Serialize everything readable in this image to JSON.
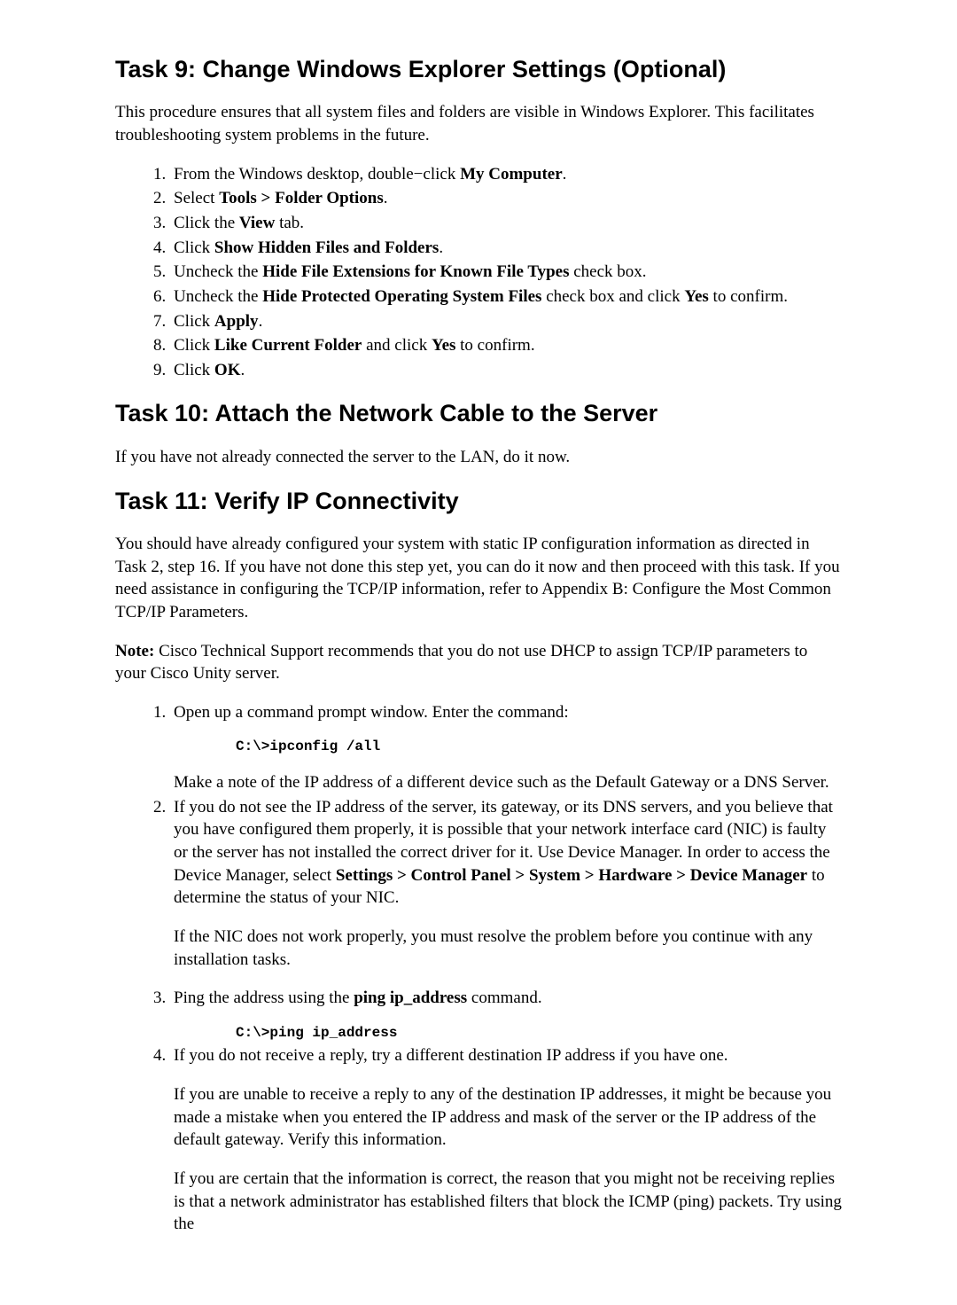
{
  "task9": {
    "heading": "Task 9: Change Windows Explorer Settings (Optional)",
    "intro": "This procedure ensures that all system files and folders are visible in Windows Explorer. This facilitates troubleshooting system problems in the future.",
    "steps": {
      "s1_pre": "From the Windows desktop, double−click ",
      "s1_b": "My Computer",
      "s1_post": ".",
      "s2_pre": "Select ",
      "s2_b": "Tools > Folder Options",
      "s2_post": ".",
      "s3_pre": "Click the ",
      "s3_b": "View",
      "s3_post": " tab.",
      "s4_pre": "Click ",
      "s4_b": "Show Hidden Files and Folders",
      "s4_post": ".",
      "s5_pre": "Uncheck the ",
      "s5_b": "Hide File Extensions for Known File Types",
      "s5_post": " check box.",
      "s6_pre": "Uncheck the ",
      "s6_b1": "Hide Protected Operating System Files",
      "s6_mid": " check box and click ",
      "s6_b2": "Yes",
      "s6_post": " to confirm.",
      "s7_pre": "Click ",
      "s7_b": "Apply",
      "s7_post": ".",
      "s8_pre": "Click ",
      "s8_b1": "Like Current Folder",
      "s8_mid": " and click ",
      "s8_b2": "Yes",
      "s8_post": " to confirm.",
      "s9_pre": "Click ",
      "s9_b": "OK",
      "s9_post": "."
    }
  },
  "task10": {
    "heading": "Task 10: Attach the Network Cable to the Server",
    "intro": "If you have not already connected the server to the LAN, do it now."
  },
  "task11": {
    "heading": "Task 11: Verify IP Connectivity",
    "intro": "You should have already configured your system with static IP configuration information as directed in Task 2, step 16. If you have not done this step yet, you can do it now and then proceed with this task. If you need assistance in configuring the TCP/IP information, refer to Appendix B: Configure the Most Common TCP/IP Parameters.",
    "note_label": "Note:",
    "note_body": " Cisco Technical Support recommends that you do not use DHCP to assign TCP/IP parameters to your Cisco Unity server.",
    "steps": {
      "s1_text": "Open up a command prompt window. Enter the command:",
      "s1_code": "C:\\>ipconfig /all",
      "s1_after": "Make a note of the IP address of a different device such as the Default Gateway or a DNS Server.",
      "s2_p1a": "If you do not see the IP address of the server, its gateway, or its DNS servers, and you believe that you have configured them properly, it is possible that your network interface card (NIC) is faulty or the server has not installed the correct driver for it. Use Device Manager. In order to access the Device Manager, select ",
      "s2_b": "Settings > Control Panel > System > Hardware > Device Manager",
      "s2_p1b": " to determine the status of your NIC.",
      "s2_p2": "If the NIC does not work properly, you must resolve the problem before you continue with any installation tasks.",
      "s3_pre": "Ping the address using the ",
      "s3_b": "ping ip_address",
      "s3_post": " command.",
      "s3_code": "C:\\>ping ip_address",
      "s4_p1": "If you do not receive a reply, try a different destination IP address if you have one.",
      "s4_p2": "If you are unable to receive a reply to any of the destination IP addresses, it might be because you made a mistake when you entered the IP address and mask of the server or the IP address of the default gateway. Verify this information.",
      "s4_p3": "If you are certain that the information is correct, the reason that you might not be receiving replies is that a network administrator has established filters that block the ICMP (ping) packets. Try using the"
    }
  }
}
